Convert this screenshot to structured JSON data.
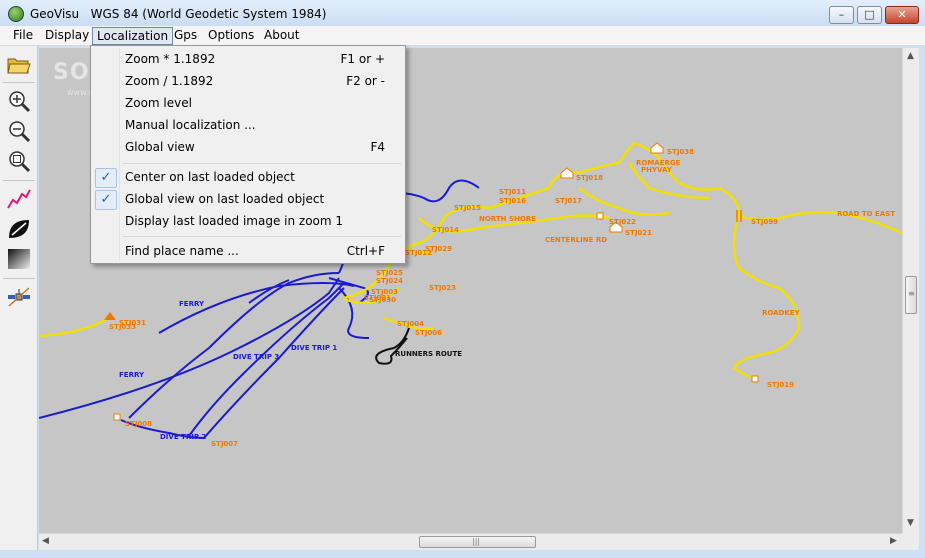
{
  "window": {
    "app_name": "GeoVisu",
    "subtitle": "WGS 84 (World Geodetic System 1984)",
    "minimize": "–",
    "maximize": "□",
    "close": "✕"
  },
  "menubar": {
    "items": [
      "File",
      "Display",
      "Localization",
      "Gps",
      "Options",
      "About"
    ],
    "active": "Localization"
  },
  "dropdown": {
    "items": [
      {
        "label": "Zoom * 1.1892",
        "shortcut": "F1 or +",
        "checked": false
      },
      {
        "label": "Zoom / 1.1892",
        "shortcut": "F2 or -",
        "checked": false
      },
      {
        "label": "Zoom level",
        "shortcut": "",
        "checked": false
      },
      {
        "label": "Manual localization ...",
        "shortcut": "",
        "checked": false
      },
      {
        "label": "Global view",
        "shortcut": "F4",
        "checked": false
      },
      {
        "label": "Center on last loaded object",
        "shortcut": "",
        "checked": true
      },
      {
        "label": "Global view on last loaded object",
        "shortcut": "",
        "checked": true
      },
      {
        "label": "Display last loaded image in zoom 1",
        "shortcut": "",
        "checked": false
      },
      {
        "label": "Find place name ...",
        "shortcut": "Ctrl+F",
        "checked": false
      }
    ],
    "check_glyph": "✓"
  },
  "toolbar": {
    "tools": [
      "open-folder-icon",
      "zoom-in-icon",
      "zoom-out-icon",
      "zoom-fit-icon",
      "track-icon",
      "shape-icon",
      "gradient-icon",
      "satellite-icon"
    ]
  },
  "map": {
    "watermark": "SOFTPEDIA",
    "watermark_url": "www.softpedia.com",
    "colors": {
      "background": "#c6c6c6",
      "yellow_track": "#f2e000",
      "blue_track": "#1a1ad0",
      "label_orange": "#f07800",
      "label_blue": "#1a1ad0"
    },
    "labels_orange": [
      "STJ038",
      "ROMAERGE",
      "PHYVAY",
      "STJ011",
      "STJ016",
      "STJ018",
      "STJ015",
      "STJ017",
      "NORTH SHORE",
      "STJ022",
      "STJ021",
      "CENTERLINE RD",
      "STJ099",
      "ROAD TO EAST",
      "STJ014",
      "STJ029",
      "STJ012",
      "STJ025",
      "STJ024",
      "STJ023",
      "STJ003",
      "STJ001",
      "STJ030",
      "STJ004",
      "STJ006",
      "STJ031",
      "STJ033",
      "STJ008",
      "STJ007",
      "STJ019",
      "ROADKEY"
    ],
    "labels_blue": [
      "FERRY",
      "FERRY",
      "DIVE TRIP 3",
      "DIVE TRIP 1",
      "DIVE TRIP 2"
    ],
    "label_black": "RUNNERS ROUTE"
  }
}
